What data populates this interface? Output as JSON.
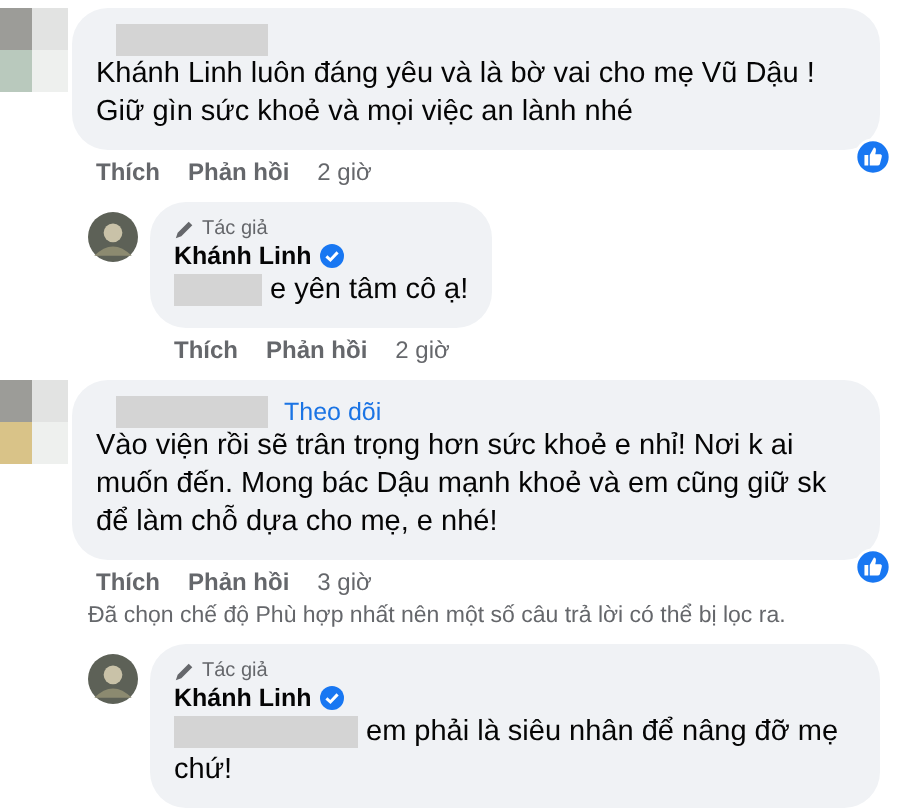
{
  "items": [
    {
      "kind": "comment",
      "author_redacted": true,
      "text": "Khánh Linh luôn đáng yêu và là bờ vai cho mẹ Vũ Dậu ! Giữ gìn sức khoẻ và mọi việc an lành nhé",
      "liked": true,
      "actions": [
        "Thích",
        "Phản hồi"
      ],
      "time": "2 giờ"
    },
    {
      "kind": "reply",
      "badge": "Tác giả",
      "author": "Khánh Linh",
      "verified": true,
      "text_redacted_prefix": true,
      "text": "e yên tâm cô ạ!",
      "actions": [
        "Thích",
        "Phản hồi"
      ],
      "time": "2 giờ"
    },
    {
      "kind": "comment",
      "author_redacted": true,
      "follow": "Theo dõi",
      "text": "Vào viện rồi sẽ trân trọng hơn sức khoẻ e nhỉ! Nơi k ai muốn đến. Mong bác Dậu mạnh khoẻ và em cũng giữ sk để làm chỗ dựa cho mẹ, e nhé!",
      "liked": true,
      "actions": [
        "Thích",
        "Phản hồi"
      ],
      "time": "3 giờ"
    },
    {
      "kind": "notice",
      "text": "Đã chọn chế độ Phù hợp nhất nên một số câu trả lời có thể bị lọc ra."
    },
    {
      "kind": "reply",
      "badge": "Tác giả",
      "author": "Khánh Linh",
      "verified": true,
      "text_redacted_prefix": true,
      "text": "em phải là siêu nhân để nâng đỡ mẹ chứ!"
    }
  ]
}
